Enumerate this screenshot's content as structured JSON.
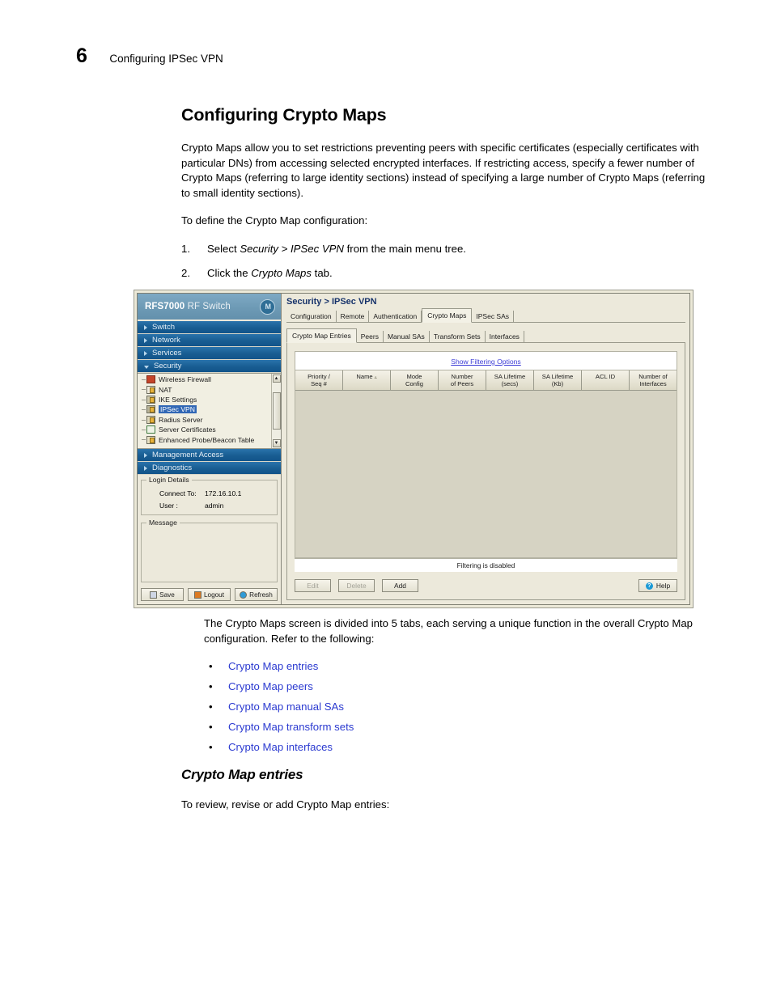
{
  "page_header": {
    "chapter_number": "6",
    "chapter_title": "Configuring IPSec VPN"
  },
  "section": {
    "title": "Configuring Crypto Maps",
    "intro": "Crypto Maps allow you to set restrictions preventing peers with specific certificates (especially certificates with particular DNs) from accessing selected encrypted interfaces. If restricting access, specify a fewer number of Crypto Maps (referring to large identity sections) instead of specifying a large number of Crypto Maps (referring to small identity sections).",
    "lead_in": "To define the Crypto Map configuration:",
    "steps": [
      {
        "num": "1.",
        "pre": "Select ",
        "em": "Security > IPSec VPN",
        "post": " from the main menu tree."
      },
      {
        "num": "2.",
        "pre": "Click the ",
        "em": "Crypto Maps",
        "post": " tab."
      }
    ]
  },
  "screenshot": {
    "brand": {
      "model": "RFS7000",
      "suffix": " RF Switch",
      "logo": "motorola-logo"
    },
    "nav_groups": [
      {
        "label": "Switch",
        "expanded": false
      },
      {
        "label": "Network",
        "expanded": false
      },
      {
        "label": "Services",
        "expanded": false
      },
      {
        "label": "Security",
        "expanded": true
      },
      {
        "label": "Management Access",
        "expanded": false
      },
      {
        "label": "Diagnostics",
        "expanded": false
      }
    ],
    "tree_items": [
      {
        "label": "Wireless Firewall",
        "icon": "firewall",
        "selected": false
      },
      {
        "label": "NAT",
        "icon": "nat",
        "selected": false
      },
      {
        "label": "IKE Settings",
        "icon": "ike",
        "selected": false
      },
      {
        "label": "IPSec VPN",
        "icon": "vpn",
        "selected": true
      },
      {
        "label": "Radius Server",
        "icon": "radius",
        "selected": false
      },
      {
        "label": "Server Certificates",
        "icon": "cert",
        "selected": false
      },
      {
        "label": "Enhanced Probe/Beacon Table",
        "icon": "probe",
        "selected": false
      }
    ],
    "login_details": {
      "legend": "Login Details",
      "connect_to_label": "Connect To:",
      "connect_to_value": "172.16.10.1",
      "user_label": "User :",
      "user_value": "admin"
    },
    "message_panel": {
      "legend": "Message",
      "content": ""
    },
    "login_buttons": [
      {
        "label": "Save",
        "icon": "save-icon"
      },
      {
        "label": "Logout",
        "icon": "logout-icon"
      },
      {
        "label": "Refresh",
        "icon": "refresh-icon"
      }
    ],
    "breadcrumb": "Security > IPSec VPN",
    "main_tabs": [
      {
        "label": "Configuration",
        "active": false
      },
      {
        "label": "Remote",
        "active": false
      },
      {
        "label": "Authentication",
        "active": false
      },
      {
        "label": "Crypto Maps",
        "active": true
      },
      {
        "label": "IPSec SAs",
        "active": false
      }
    ],
    "sub_tabs": [
      {
        "label": "Crypto Map Entries",
        "active": true
      },
      {
        "label": "Peers",
        "active": false
      },
      {
        "label": "Manual SAs",
        "active": false
      },
      {
        "label": "Transform Sets",
        "active": false
      },
      {
        "label": "Interfaces",
        "active": false
      }
    ],
    "filter_link": "Show Filtering Options",
    "grid_columns": [
      {
        "line1": "Priority /",
        "line2": "Seq #",
        "sorted": false
      },
      {
        "line1": "Name",
        "line2": "",
        "sorted": true
      },
      {
        "line1": "Mode",
        "line2": "Config",
        "sorted": false
      },
      {
        "line1": "Number",
        "line2": "of Peers",
        "sorted": false
      },
      {
        "line1": "SA Lifetime",
        "line2": "(secs)",
        "sorted": false
      },
      {
        "line1": "SA Lifetime",
        "line2": "(Kb)",
        "sorted": false
      },
      {
        "line1": "ACL ID",
        "line2": "",
        "sorted": false
      },
      {
        "line1": "Number of",
        "line2": "Interfaces",
        "sorted": false
      }
    ],
    "grid_rows": [],
    "grid_status": "Filtering is disabled",
    "action_buttons": [
      {
        "label": "Edit",
        "disabled": true
      },
      {
        "label": "Delete",
        "disabled": true
      },
      {
        "label": "Add",
        "disabled": false
      }
    ],
    "help_button": {
      "label": "Help",
      "icon": "help-icon"
    }
  },
  "lower": {
    "paragraph": "The Crypto Maps screen is divided into 5 tabs, each serving a unique function in the overall Crypto Map configuration. Refer to the following:",
    "links": [
      "Crypto Map entries",
      "Crypto Map peers",
      "Crypto Map manual SAs",
      "Crypto Map transform sets",
      "Crypto Map interfaces"
    ],
    "sub_title": "Crypto Map entries",
    "closing": "To review, revise or add Crypto Map entries:"
  },
  "colors": {
    "link_blue": "#2b3ad0",
    "breadcrumb_blue": "#17336b",
    "brand_blue": "#6d9ab5",
    "nav_blue": "#185d92",
    "selection_blue": "#3167b5",
    "panel_bg": "#ece9db"
  }
}
